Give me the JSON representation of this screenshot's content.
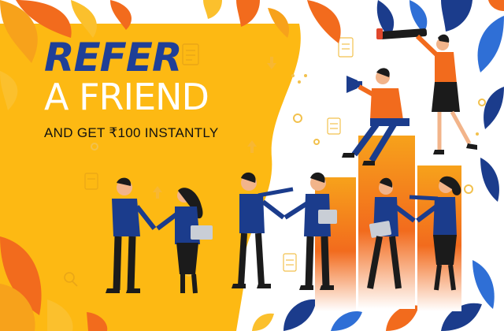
{
  "banner": {
    "headline_line1": "REFER",
    "headline_line2": "A FRIEND",
    "tagline": "AND GET ₹100 INSTANTLY"
  },
  "colors": {
    "yellow_panel": "#fdb913",
    "headline_blue": "#1f3f97",
    "accent_orange": "#f26b1d",
    "leaf_navy": "#1b3c8c"
  },
  "illustration": {
    "icons": [
      "document-icon",
      "arrow-up-icon",
      "circle-icon",
      "magnifier-icon",
      "megaphone-icon",
      "telescope-icon",
      "laptop-icon"
    ]
  }
}
